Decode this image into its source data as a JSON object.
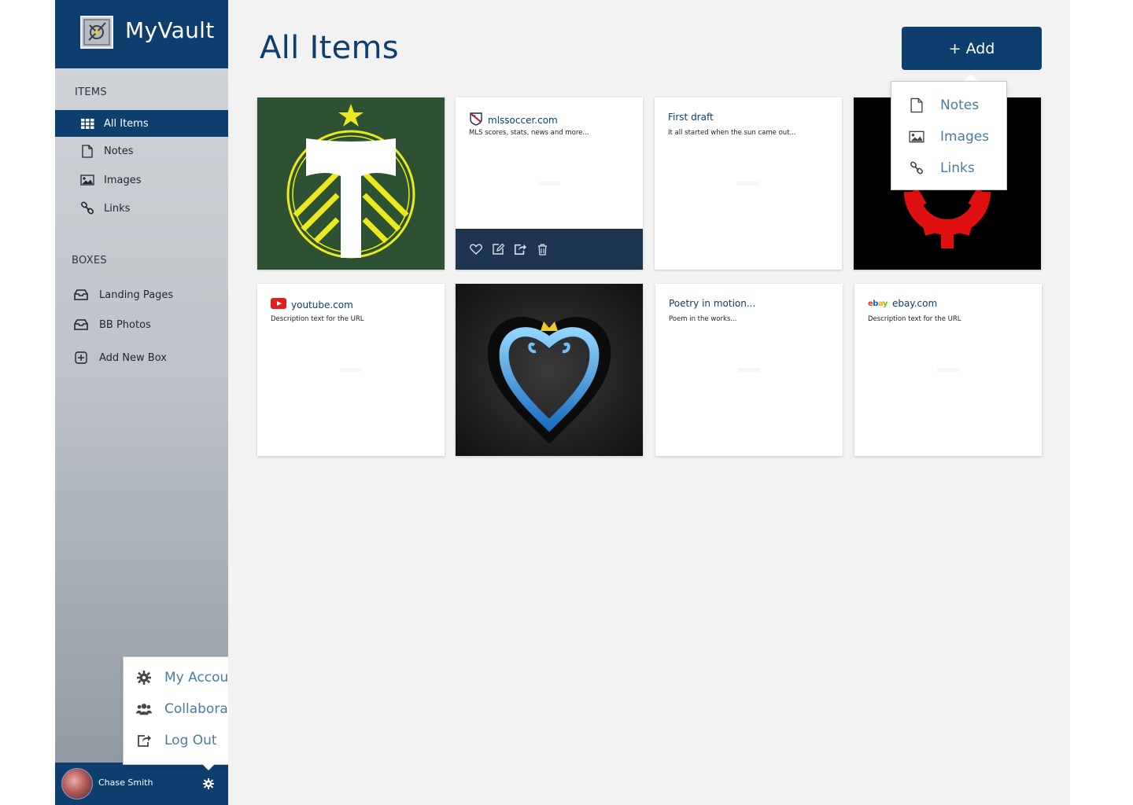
{
  "app": {
    "title": "MyVault"
  },
  "sidebar": {
    "items_label": "ITEMS",
    "items": [
      {
        "label": "All Items",
        "icon": "grid-icon",
        "active": true
      },
      {
        "label": "Notes",
        "icon": "note-icon"
      },
      {
        "label": "Images",
        "icon": "image-icon"
      },
      {
        "label": "Links",
        "icon": "link-icon"
      }
    ],
    "boxes_label": "BOXES",
    "boxes": [
      {
        "label": "Landing Pages",
        "icon": "inbox-icon"
      },
      {
        "label": "BB Photos",
        "icon": "inbox-icon"
      },
      {
        "label": "Add New Box",
        "icon": "plus-box-icon"
      }
    ]
  },
  "user": {
    "name": "Chase Smith"
  },
  "user_menu": {
    "items": [
      {
        "label": "My Account",
        "icon": "gear-icon"
      },
      {
        "label": "Collaborators",
        "icon": "users-icon"
      },
      {
        "label": "Log Out",
        "icon": "logout-icon"
      }
    ]
  },
  "main": {
    "title": "All Items",
    "add_label": "+ Add"
  },
  "add_menu": {
    "items": [
      {
        "label": "Notes",
        "icon": "note-icon"
      },
      {
        "label": "Images",
        "icon": "image-icon"
      },
      {
        "label": "Links",
        "icon": "link-icon"
      }
    ]
  },
  "cards": [
    {
      "type": "image",
      "image": "timbers-logo"
    },
    {
      "type": "link",
      "title": "mlssoccer.com",
      "desc": "MLS scores, stats, news and more...",
      "icon": "mls-icon"
    },
    {
      "type": "note",
      "title": "First draft",
      "desc": "It all started when the sun came out..."
    },
    {
      "type": "image",
      "image": "red-gear-logo"
    },
    {
      "type": "link",
      "title": "youtube.com",
      "desc": "Description text for the URL",
      "icon": "youtube-icon"
    },
    {
      "type": "image",
      "image": "kingdom-hearts-heart"
    },
    {
      "type": "note",
      "title": "Poetry in motion...",
      "desc": "Poem in the works..."
    },
    {
      "type": "link",
      "title": "ebay.com",
      "desc": "Description text for the URL",
      "icon": "ebay-icon",
      "icon_text": "ebay"
    }
  ],
  "colors": {
    "primary": "#0d3e6e",
    "link": "#4b7aa0",
    "actions_bar": "#1d3550"
  }
}
